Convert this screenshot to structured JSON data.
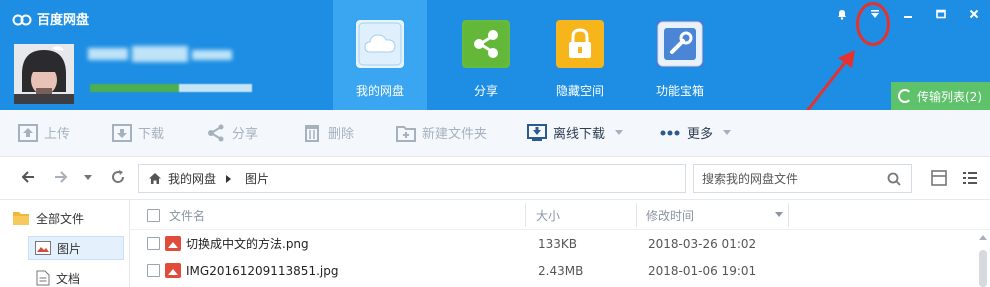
{
  "app": {
    "title": "百度网盘"
  },
  "nav": [
    {
      "label": "我的网盘",
      "icon": "cloud-icon",
      "active": true
    },
    {
      "label": "分享",
      "icon": "share-icon"
    },
    {
      "label": "隐藏空间",
      "icon": "lock-icon"
    },
    {
      "label": "功能宝箱",
      "icon": "toolbox-icon"
    }
  ],
  "window_controls": [
    "bell-icon",
    "dropdown-icon",
    "minimize-icon",
    "maximize-icon",
    "close-icon"
  ],
  "transfer": {
    "label": "传输列表(2)"
  },
  "toolbar": {
    "upload": "上传",
    "download": "下载",
    "share": "分享",
    "delete": "删除",
    "new_folder": "新建文件夹",
    "offline_download": "离线下载",
    "more": "更多"
  },
  "breadcrumb": {
    "root": "我的网盘",
    "current": "图片"
  },
  "search": {
    "placeholder": "搜索我的网盘文件"
  },
  "sidebar": {
    "items": [
      {
        "label": "全部文件"
      },
      {
        "label": "图片"
      },
      {
        "label": "文档"
      }
    ]
  },
  "list": {
    "columns": {
      "name": "文件名",
      "size": "大小",
      "modified": "修改时间"
    },
    "rows": [
      {
        "name": "切换成中文的方法.png",
        "size": "133KB",
        "modified": "2018-03-26 01:02"
      },
      {
        "name": "IMG20161209113851.jpg",
        "size": "2.43MB",
        "modified": "2018-01-06 19:01"
      }
    ]
  },
  "colors": {
    "header": "#1d8ee3",
    "nav_active": "#3aa5f1",
    "transfer": "#5ec26a",
    "annotation": "#e5322e"
  }
}
